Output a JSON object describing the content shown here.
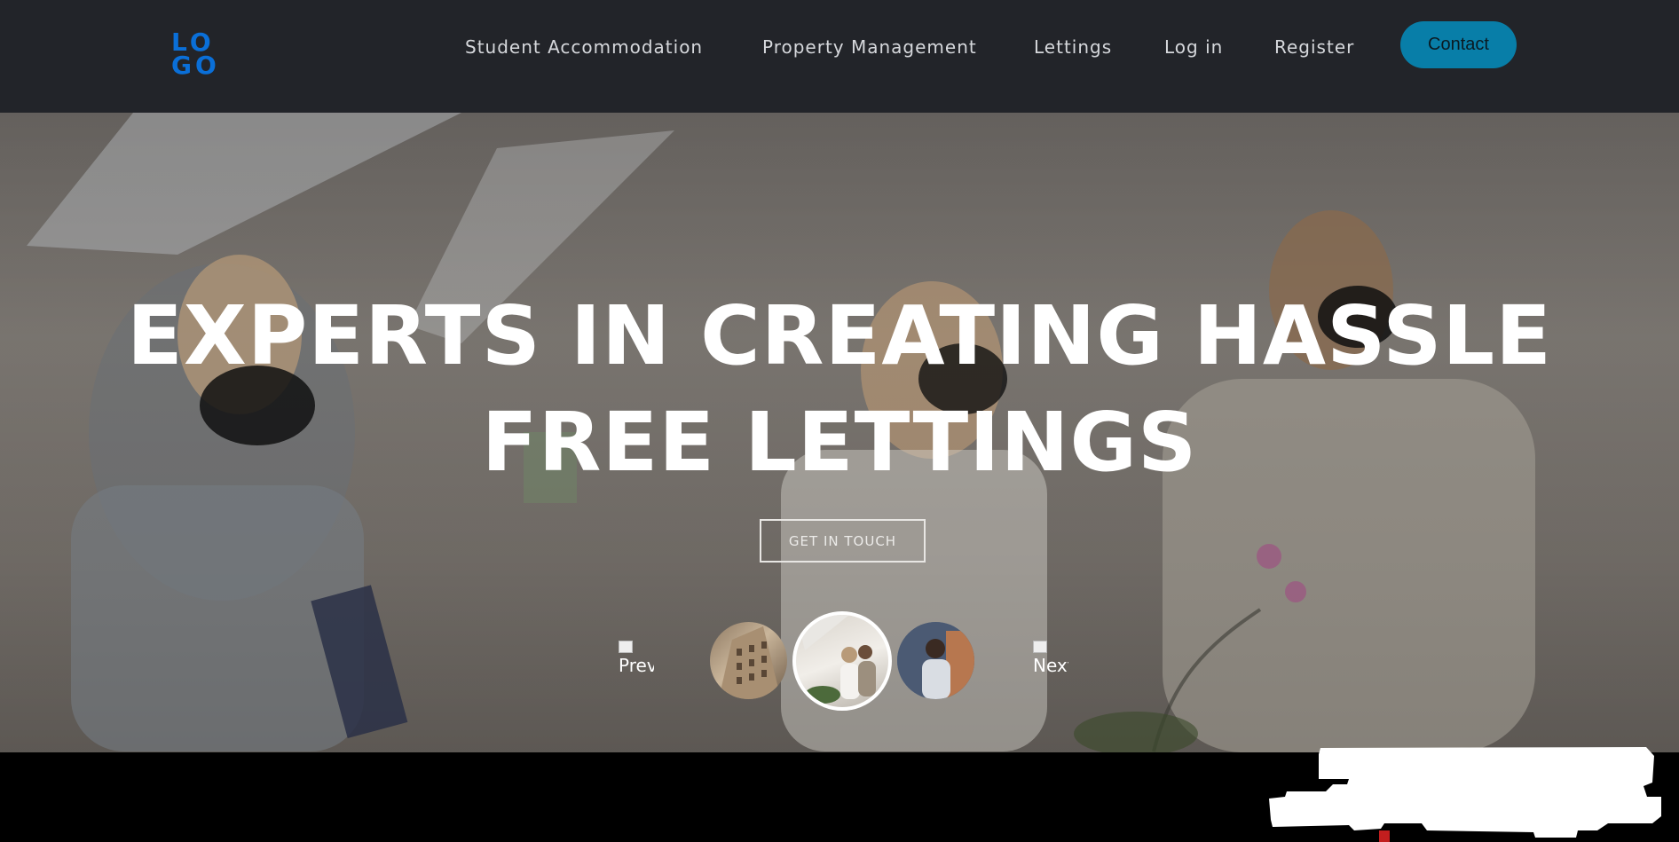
{
  "header": {
    "logo": {
      "line1": "LO",
      "line2": "GO"
    },
    "nav": [
      {
        "label": "Student Accommodation"
      },
      {
        "label": "Property Management"
      },
      {
        "label": "Lettings"
      },
      {
        "label": "Log in"
      },
      {
        "label": "Register"
      }
    ],
    "contact_label": "Contact"
  },
  "hero": {
    "title_line1": "EXPERTS IN CREATING HASSLE",
    "title_line2": "FREE LETTINGS",
    "cta_label": "GET IN TOUCH",
    "prev_label": "Prev",
    "next_label": "Next",
    "thumbnails": [
      {
        "icon": "building-photo"
      },
      {
        "icon": "people-elbow-bump-photo",
        "active": true
      },
      {
        "icon": "student-photo"
      }
    ]
  },
  "colors": {
    "header_bg": "#222429",
    "accent": "#087ea8",
    "logo": "#0a6fd8"
  }
}
